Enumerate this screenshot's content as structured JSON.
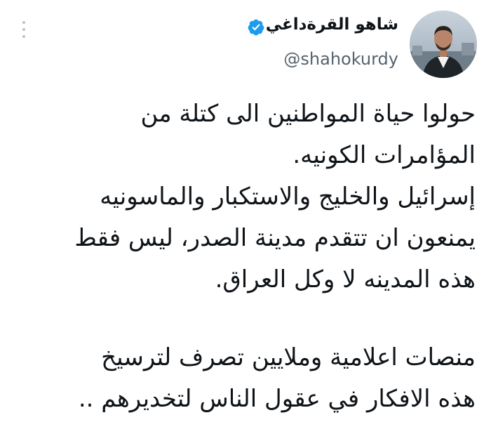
{
  "tweet": {
    "author": {
      "display_name": "شاهو القرةداغي",
      "handle": "@shahokurdy",
      "verified": true,
      "avatar_icon": "user-photo"
    },
    "paragraphs": [
      [
        "حولوا حياة المواطنين الى كتلة من",
        "المؤامرات الكونيه.",
        "إسرائيل والخليج والاستكبار والماسونيه",
        "يمنعون ان تتقدم مدينة الصدر، ليس فقط",
        "هذه المدينه لا وكل العراق."
      ],
      [
        "منصات اعلامية وملايين تصرف لترسيخ",
        "هذه الافكار في عقول الناس لتخديرهم .."
      ]
    ],
    "colors": {
      "verified": "#1d9bf0",
      "text": "#0f1419",
      "secondary": "#536471"
    }
  }
}
